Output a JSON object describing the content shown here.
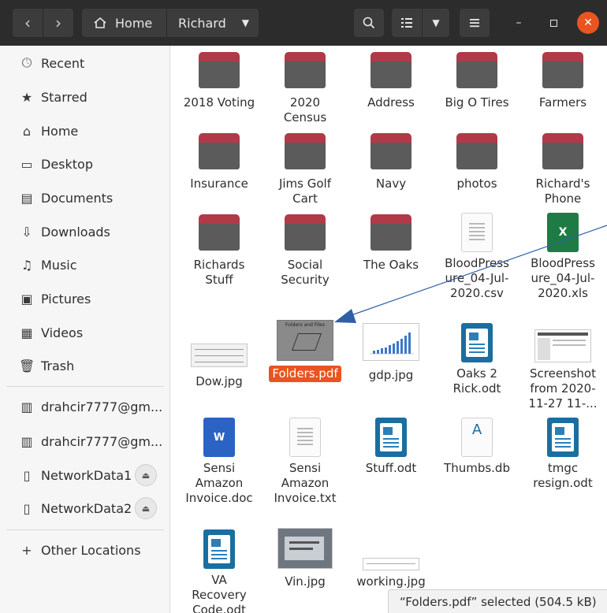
{
  "header": {
    "back_icon": "chevron-left-icon",
    "forward_icon": "chevron-right-icon",
    "breadcrumb_home": "Home",
    "breadcrumb_current": "Richard",
    "search_icon": "search-icon",
    "view_icon": "list-view-icon",
    "menu_icon": "hamburger-menu-icon"
  },
  "sidebar": {
    "items": [
      {
        "label": "Recent",
        "icon": "clock-icon"
      },
      {
        "label": "Starred",
        "icon": "star-icon"
      },
      {
        "label": "Home",
        "icon": "home-icon"
      },
      {
        "label": "Desktop",
        "icon": "desktop-icon"
      },
      {
        "label": "Documents",
        "icon": "documents-icon"
      },
      {
        "label": "Downloads",
        "icon": "download-icon"
      },
      {
        "label": "Music",
        "icon": "music-icon"
      },
      {
        "label": "Pictures",
        "icon": "pictures-icon"
      },
      {
        "label": "Videos",
        "icon": "videos-icon"
      },
      {
        "label": "Trash",
        "icon": "trash-icon"
      }
    ],
    "network": [
      {
        "label": "drahcir7777@gm...",
        "icon": "network-drive-icon"
      },
      {
        "label": "drahcir7777@gm...",
        "icon": "network-drive-icon"
      },
      {
        "label": "NetworkData1",
        "icon": "usb-drive-icon"
      },
      {
        "label": "NetworkData2",
        "icon": "usb-drive-icon"
      }
    ],
    "other": {
      "label": "Other Locations",
      "icon": "plus-icon"
    }
  },
  "files": [
    {
      "name": "2018 Voting"
    },
    {
      "name": "2020 Census"
    },
    {
      "name": "Address"
    },
    {
      "name": "Big O Tires"
    },
    {
      "name": "Farmers"
    },
    {
      "name": "Insurance"
    },
    {
      "name": "Jims Golf Cart"
    },
    {
      "name": "Navy"
    },
    {
      "name": "photos"
    },
    {
      "name": "Richard's Phone"
    },
    {
      "name": "Richards Stuff"
    },
    {
      "name": "Social Security"
    },
    {
      "name": "The Oaks"
    },
    {
      "name": "BloodPressure_04-Jul-2020.csv"
    },
    {
      "name": "BloodPressure_04-Jul-2020.xls"
    },
    {
      "name": "Dow.jpg"
    },
    {
      "name": "Folders.pdf"
    },
    {
      "name": "gdp.jpg"
    },
    {
      "name": "Oaks 2 Rick.odt"
    },
    {
      "name": "Screenshot from 2020-11-27 11-..."
    },
    {
      "name": "Sensi Amazon Invoice.doc"
    },
    {
      "name": "Sensi Amazon Invoice.txt"
    },
    {
      "name": "Stuff.odt"
    },
    {
      "name": "Thumbs.db"
    },
    {
      "name": "tmgc resign.odt"
    },
    {
      "name": "VA Recovery Code.odt"
    },
    {
      "name": "Vin.jpg"
    },
    {
      "name": "working.jpg"
    }
  ],
  "thumb_text": {
    "folders_pdf_title": "Folders and Files",
    "xls_badge": "X",
    "doc_badge": "W",
    "db_badge": "A"
  },
  "status": "“Folders.pdf” selected  (504.5 kB)",
  "colors": {
    "accent": "#e95420",
    "folder_tab": "#b03a48",
    "folder_body": "#5b5b5b",
    "header": "#2c2c2c",
    "arrow": "#2f5fa7"
  }
}
